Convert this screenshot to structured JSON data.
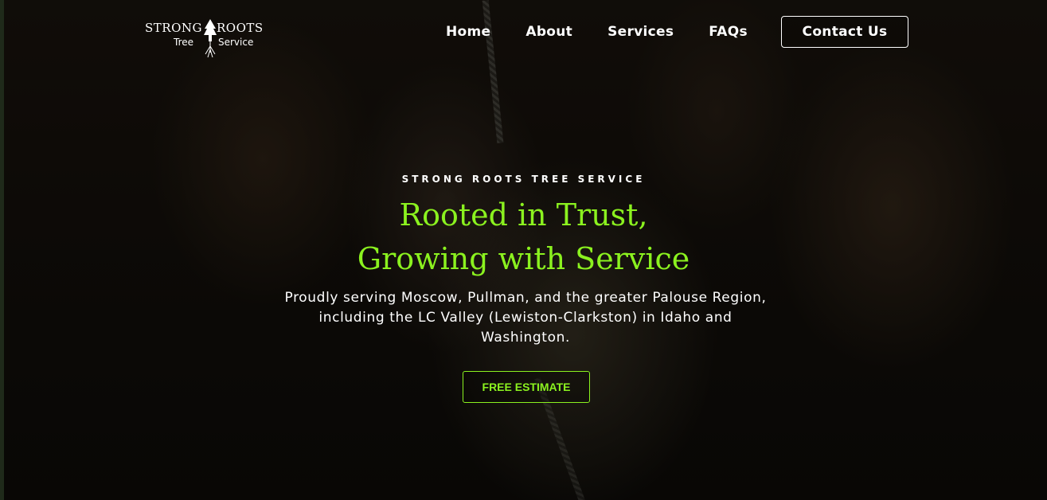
{
  "brand": {
    "word_left": "STRONG",
    "word_right": "ROOTS",
    "sub_left": "Tree",
    "sub_right": "Service"
  },
  "nav": {
    "items": [
      {
        "label": "Home"
      },
      {
        "label": "About"
      },
      {
        "label": "Services"
      },
      {
        "label": "FAQs"
      }
    ],
    "contact_label": "Contact Us"
  },
  "hero": {
    "eyebrow": "STRONG ROOTS TREE SERVICE",
    "headline_line1": "Rooted in Trust,",
    "headline_line2": "Growing with Service",
    "description": "Proudly serving Moscow, Pullman, and the greater Palouse Region, including the LC Valley (Lewiston-Clarkston) in Idaho and Washington.",
    "cta_label": "FREE ESTIMATE"
  },
  "colors": {
    "accent": "#8bf21f",
    "text": "#ffffff",
    "background": "#0b0a08"
  }
}
